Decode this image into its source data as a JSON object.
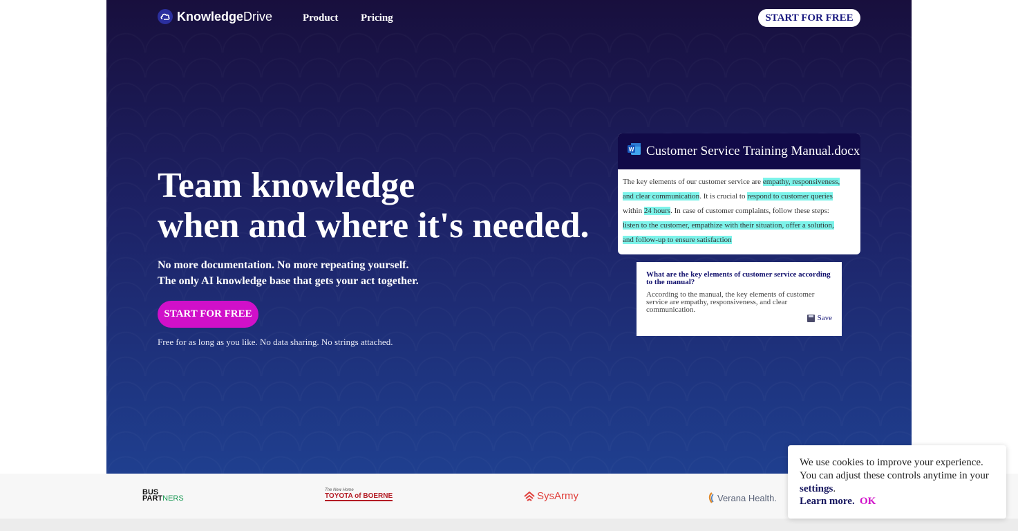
{
  "nav": {
    "brand_bold": "Knowledge",
    "brand_light": "Drive",
    "links": [
      "Product",
      "Pricing"
    ],
    "cta": "START FOR FREE"
  },
  "hero": {
    "headline_line1": "Team knowledge",
    "headline_line2": "when and where it's needed.",
    "sub_line1": "No more documentation. No more repeating yourself.",
    "sub_line2": "The only AI knowledge base that gets your act together.",
    "cta": "START FOR FREE",
    "fine_print": "Free for as long as you like. No data sharing. No strings attached."
  },
  "doc_card": {
    "icon": "word-doc-icon",
    "title": "Customer Service Training Manual.docx",
    "segments": [
      {
        "text": "The key elements of our customer service are ",
        "highlight": false
      },
      {
        "text": "empathy, responsiveness, and clear communication",
        "highlight": true
      },
      {
        "text": ". It is crucial to ",
        "highlight": false
      },
      {
        "text": "respond to customer queries",
        "highlight": true
      },
      {
        "text": " within ",
        "highlight": false
      },
      {
        "text": "24 hours",
        "highlight": true
      },
      {
        "text": ". In case of customer complaints, follow these steps: ",
        "highlight": false
      },
      {
        "text": "listen to the customer, empathize with their situation, offer a solution, and follow-up to ensure satisfaction",
        "highlight": true
      }
    ]
  },
  "qa_card": {
    "question": "What are the key elements of customer service according to the manual?",
    "answer": "According to the manual, the key elements of customer service are empathy, responsiveness, and clear communication.",
    "save_label": "Save",
    "save_icon": "floppy-disk-icon"
  },
  "partners": {
    "bus_partners": {
      "line1": "BUS",
      "line2a": "PART",
      "line2b": "NERS"
    },
    "toyota": {
      "tagline": "The New Home",
      "name": "TOYOTA of BOERNE"
    },
    "sysarmy": "SysArmy",
    "verana": "Verana Health."
  },
  "cookie": {
    "text": "We use cookies to improve your experience. You can adjust these controls anytime in your ",
    "settings_link": "settings",
    "period": ".",
    "learn_more": "Learn more.",
    "ok": "OK"
  },
  "colors": {
    "hero_top": "#180f3d",
    "hero_bottom": "#1f3f8f",
    "accent_pink": "#d010c9",
    "highlight": "#7df3ea",
    "navy_text": "#16165e"
  }
}
